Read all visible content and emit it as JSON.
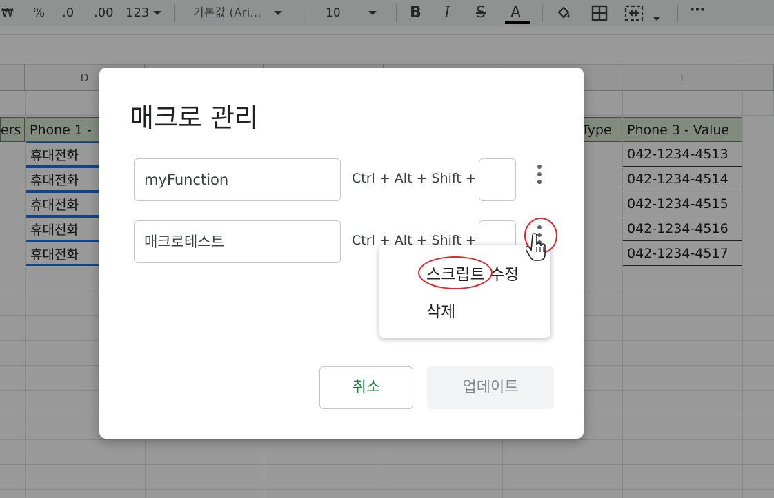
{
  "toolbar": {
    "currency": "₩",
    "percent": "%",
    "decrease_decimal": ".0",
    "increase_decimal": ".00",
    "number_format": "123",
    "font_name": "기본값 (Ari...",
    "font_size": "10",
    "bold": "B",
    "italic": "I",
    "strikethrough": "S",
    "text_color": "A",
    "more": "⋯"
  },
  "sheet": {
    "columns": [
      "D",
      "I"
    ],
    "headers": {
      "partial_left": "ers",
      "phone1": "Phone 1 -",
      "phone3_type_partial": "Type",
      "phone3_value": "Phone 3 - Value"
    },
    "rows": [
      {
        "phone1": "휴대전화",
        "phone3": "042-1234-4513"
      },
      {
        "phone1": "휴대전화",
        "phone3": "042-1234-4514"
      },
      {
        "phone1": "휴대전화",
        "phone3": "042-1234-4515"
      },
      {
        "phone1": "휴대전화",
        "phone3": "042-1234-4516"
      },
      {
        "phone1": "휴대전화",
        "phone3": "042-1234-4517"
      }
    ]
  },
  "dialog": {
    "title": "매크로 관리",
    "macros": [
      {
        "name": "myFunction",
        "shortcut_prefix": "Ctrl + Alt + Shift +",
        "key": ""
      },
      {
        "name": "매크로테스트",
        "shortcut_prefix": "Ctrl + Alt + Shift +",
        "key": ""
      }
    ],
    "cancel_label": "취소",
    "update_label": "업데이트"
  },
  "context_menu": {
    "items": [
      "스크립트 수정",
      "삭제"
    ]
  },
  "colors": {
    "annotation_red": "#e0262b",
    "header_fill": "#d9ead3",
    "cancel_text": "#188038",
    "selection_blue": "#1a73e8"
  }
}
